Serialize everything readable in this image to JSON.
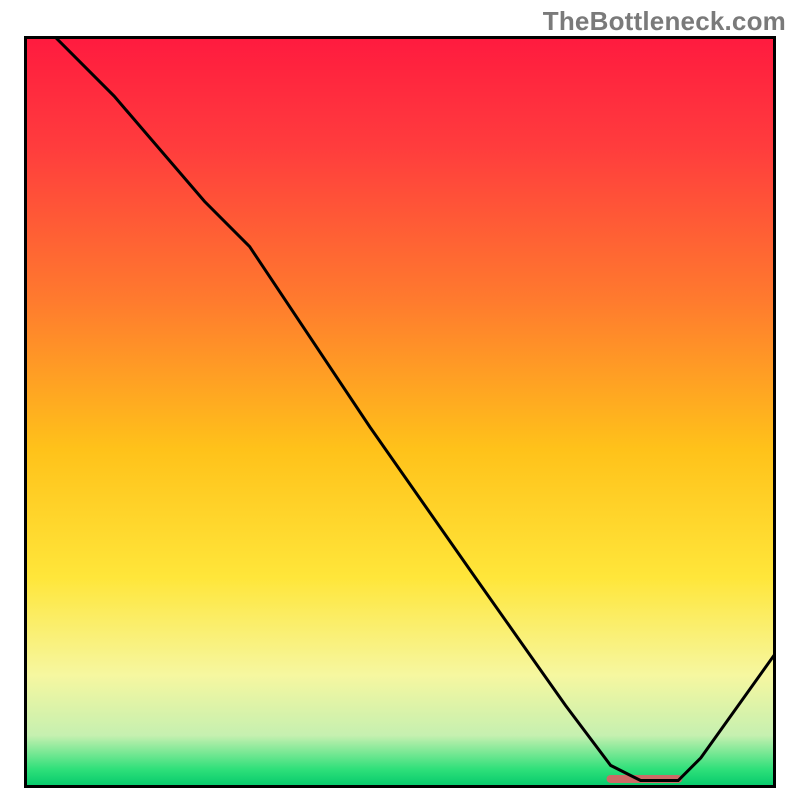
{
  "watermark": "TheBottleneck.com",
  "chart_data": {
    "type": "line",
    "title": "",
    "xlabel": "",
    "ylabel": "",
    "xlim": [
      0,
      100
    ],
    "ylim": [
      0,
      100
    ],
    "grid": false,
    "legend": false,
    "gradient_stops": [
      {
        "offset": 0.0,
        "color": "#ff1a3f"
      },
      {
        "offset": 0.15,
        "color": "#ff3d3d"
      },
      {
        "offset": 0.35,
        "color": "#ff7a2e"
      },
      {
        "offset": 0.55,
        "color": "#ffc21a"
      },
      {
        "offset": 0.72,
        "color": "#ffe63a"
      },
      {
        "offset": 0.85,
        "color": "#f6f7a0"
      },
      {
        "offset": 0.93,
        "color": "#c6f0b0"
      },
      {
        "offset": 0.975,
        "color": "#2fe07a"
      },
      {
        "offset": 1.0,
        "color": "#00c76a"
      }
    ],
    "series": [
      {
        "name": "bottleneck-curve",
        "x": [
          4,
          12,
          24,
          30,
          46,
          60,
          72,
          78,
          82,
          87,
          90,
          100
        ],
        "y": [
          100,
          92,
          78,
          72,
          48,
          28,
          11,
          3,
          1,
          1,
          4,
          18
        ]
      }
    ],
    "marker": {
      "name": "optimal-range",
      "x_start": 78,
      "x_end": 87,
      "y": 1.2,
      "color": "#cc6b66",
      "thickness": 8
    },
    "frame_color": "#000000",
    "frame_width": 3
  }
}
